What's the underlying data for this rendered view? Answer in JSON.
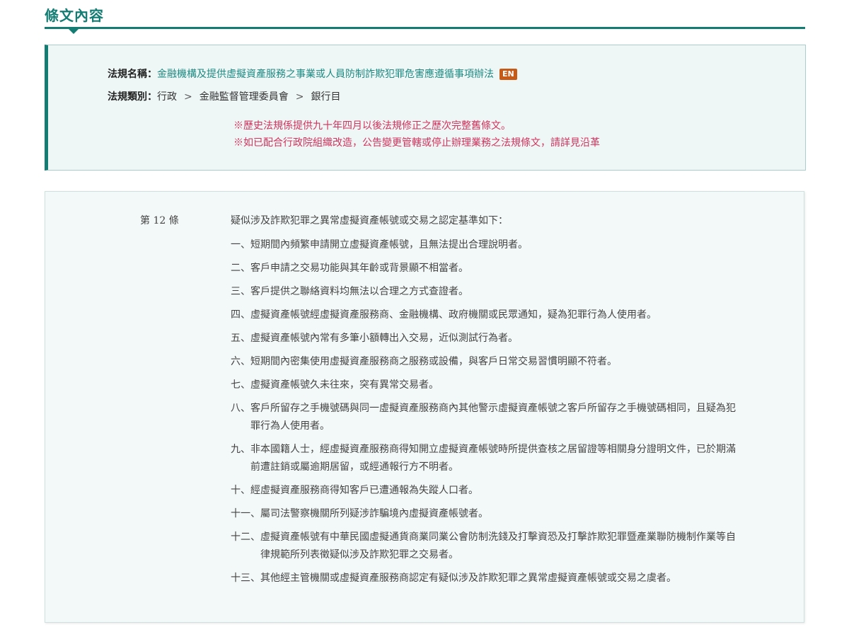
{
  "section": {
    "title": "條文內容"
  },
  "info": {
    "law_name_label": "法規名稱：",
    "law_name": "金融機構及提供虛擬資產服務之事業或人員防制詐欺犯罪危害應遵循事項辦法",
    "en_badge": "EN",
    "category_label": "法規類別：",
    "categories": [
      "行政",
      "金融監督管理委員會",
      "銀行目"
    ],
    "category_separator": ">",
    "notes": [
      "※歷史法規係提供九十年四月以後法規修正之歷次完整舊條文。",
      "※如已配合行政院組織改造，公告變更管轄或停止辦理業務之法規條文，請詳見沿革"
    ]
  },
  "article": {
    "number": "第 12 條",
    "lead": "疑似涉及詐欺犯罪之異常虛擬資產帳號或交易之認定基準如下：",
    "clauses": [
      {
        "num": "一、",
        "text": "短期間內頻繁申請開立虛擬資產帳號，且無法提出合理說明者。"
      },
      {
        "num": "二、",
        "text": "客戶申請之交易功能與其年齡或背景顯不相當者。"
      },
      {
        "num": "三、",
        "text": "客戶提供之聯絡資料均無法以合理之方式查證者。"
      },
      {
        "num": "四、",
        "text": "虛擬資產帳號經虛擬資產服務商、金融機構、政府機關或民眾通知，疑為犯罪行為人使用者。"
      },
      {
        "num": "五、",
        "text": "虛擬資產帳號內常有多筆小額轉出入交易，近似測試行為者。"
      },
      {
        "num": "六、",
        "text": "短期間內密集使用虛擬資產服務商之服務或設備，與客戶日常交易習慣明顯不符者。"
      },
      {
        "num": "七、",
        "text": "虛擬資產帳號久未往來，突有異常交易者。"
      },
      {
        "num": "八、",
        "text": "客戶所留存之手機號碼與同一虛擬資產服務商內其他警示虛擬資產帳號之客戶所留存之手機號碼相同，且疑為犯罪行為人使用者。"
      },
      {
        "num": "九、",
        "text": "非本國籍人士，經虛擬資產服務商得知開立虛擬資產帳號時所提供查核之居留證等相關身分證明文件，已於期滿前遭註銷或屬逾期居留，或經通報行方不明者。"
      },
      {
        "num": "十、",
        "text": "經虛擬資產服務商得知客戶已遭通報為失蹤人口者。"
      },
      {
        "num": "十一、",
        "text": "屬司法警察機關所列疑涉詐騙境內虛擬資產帳號者。"
      },
      {
        "num": "十二、",
        "text": "虛擬資產帳號有中華民國虛擬通貨商業同業公會防制洗錢及打擊資恐及打擊詐欺犯罪暨產業聯防機制作業等自律規範所列表徵疑似涉及詐欺犯罪之交易者。"
      },
      {
        "num": "十三、",
        "text": "其他經主管機關或虛擬資產服務商認定有疑似涉及詐欺犯罪之異常虛擬資產帳號或交易之虞者。"
      }
    ]
  },
  "colors": {
    "accent": "#137d73",
    "link": "#1f8a82",
    "note_red": "#d2335c",
    "badge": "#c85a17"
  }
}
